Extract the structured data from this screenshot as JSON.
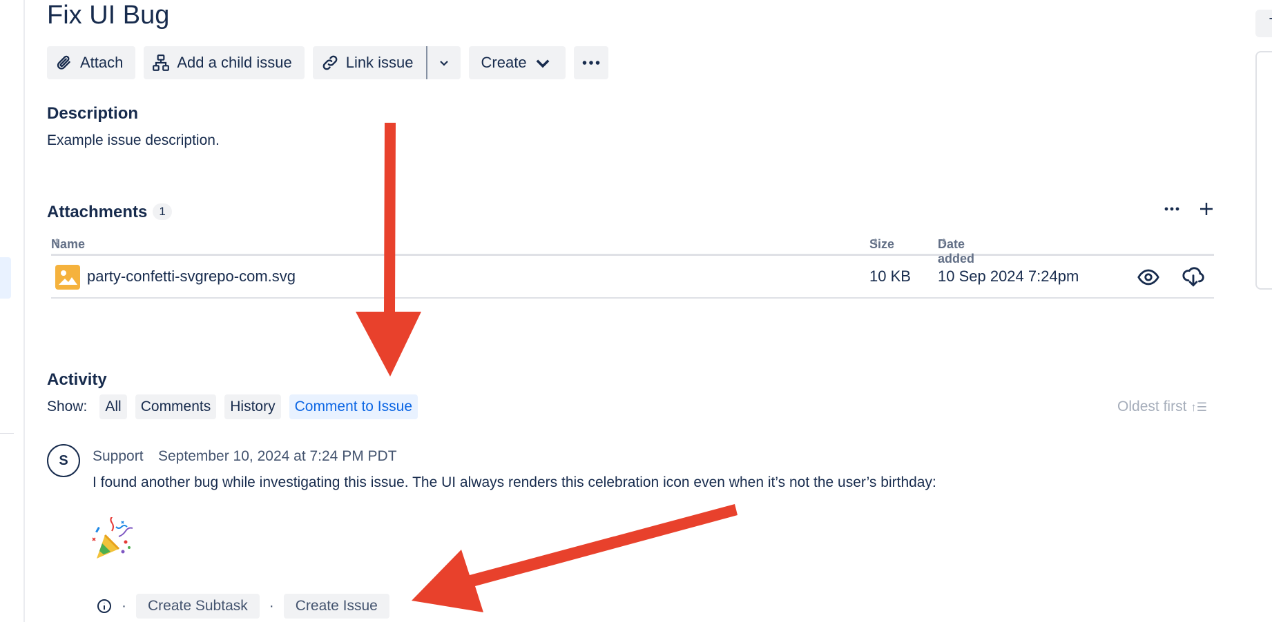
{
  "issue": {
    "title": "Fix UI Bug"
  },
  "toolbar": {
    "attach_label": "Attach",
    "add_child_label": "Add a child issue",
    "link_issue_label": "Link issue",
    "create_label": "Create"
  },
  "description": {
    "heading": "Description",
    "text": "Example issue description."
  },
  "attachments": {
    "heading": "Attachments",
    "count": "1",
    "columns": {
      "name": "Name",
      "size": "Size",
      "date_added": "Date added"
    },
    "rows": [
      {
        "name": "party-confetti-svgrepo-com.svg",
        "size": "10 KB",
        "date_added": "10 Sep 2024 7:24pm"
      }
    ]
  },
  "activity": {
    "heading": "Activity",
    "show_label": "Show:",
    "filters": [
      "All",
      "Comments",
      "History",
      "Comment to Issue"
    ],
    "active_filter": "Comment to Issue",
    "sort_label": "Oldest first"
  },
  "comment": {
    "avatar_initial": "S",
    "author": "Support",
    "timestamp": "September 10, 2024 at 7:24 PM PDT",
    "body": "I found another bug while investigating this issue. The UI always renders this celebration icon even when it’s not the user’s birthday:",
    "actions": {
      "create_subtask": "Create Subtask",
      "create_issue": "Create Issue",
      "separator": "·"
    }
  },
  "right_panel": {
    "top_letter": "T"
  },
  "colors": {
    "text_primary": "#172b4d",
    "link_blue": "#0c66e4",
    "button_bg": "#f1f2f4",
    "annotation_arrow": "#e8412c",
    "file_icon": "#f5b23d"
  }
}
